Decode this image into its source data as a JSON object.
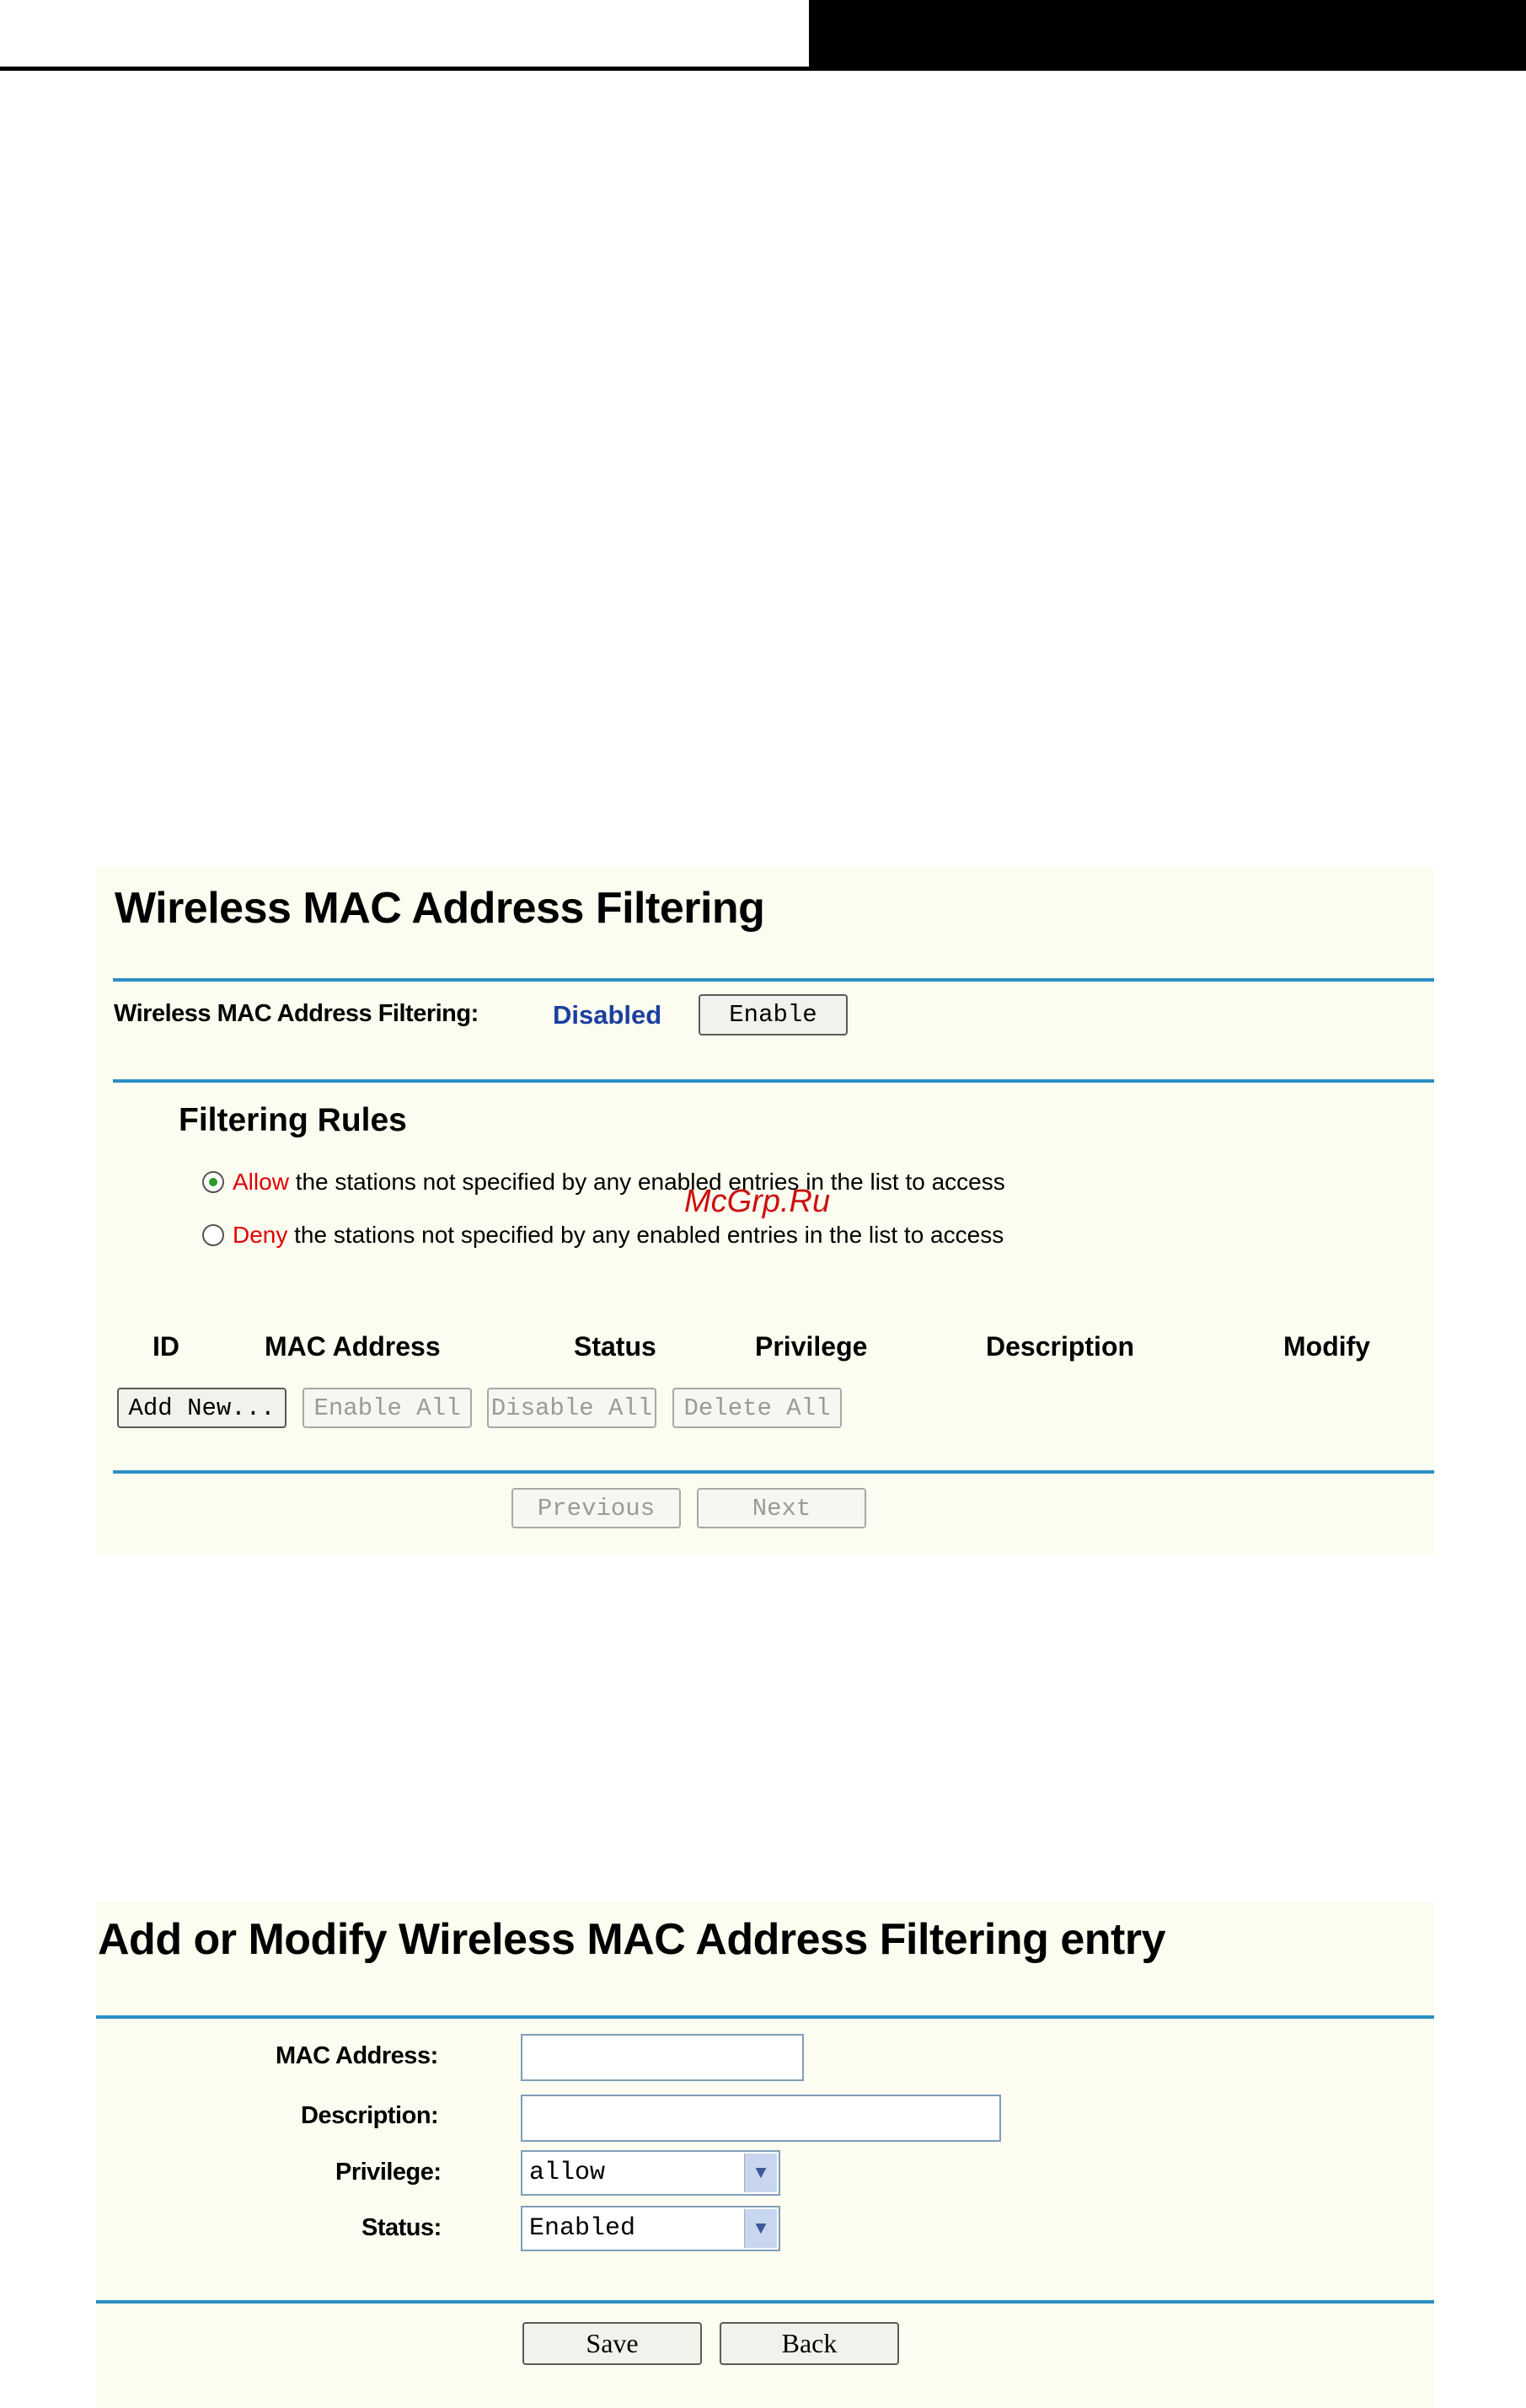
{
  "filtering_page": {
    "title": "Wireless MAC Address Filtering",
    "status_label": "Wireless MAC Address Filtering:",
    "status_value": "Disabled",
    "enable_button": "Enable",
    "rules_title": "Filtering Rules",
    "allow_word": "Allow",
    "allow_text": " the stations not specified by any enabled entries in the list to access",
    "deny_word": "Deny",
    "deny_text": " the stations not specified by any enabled entries in the list to access",
    "selected_rule": "allow",
    "columns": [
      "ID",
      "MAC Address",
      "Status",
      "Privilege",
      "Description",
      "Modify"
    ],
    "buttons": {
      "add_new": "Add New...",
      "enable_all": "Enable All",
      "disable_all": "Disable All",
      "delete_all": "Delete All",
      "previous": "Previous",
      "next": "Next"
    },
    "watermark": "McGrp.Ru"
  },
  "entry_page": {
    "title": "Add or Modify Wireless MAC Address Filtering entry",
    "mac_label": "MAC Address:",
    "mac_value": "",
    "description_label": "Description:",
    "description_value": "",
    "privilege_label": "Privilege:",
    "privilege_value": "allow",
    "status_label": "Status:",
    "status_value": "Enabled",
    "save_button": "Save",
    "back_button": "Back"
  },
  "colors": {
    "panel_bg": "#fcfcf0",
    "rule": "#2c8fc4",
    "status_blue": "#1a3fa0",
    "accent_red": "#e00000"
  }
}
